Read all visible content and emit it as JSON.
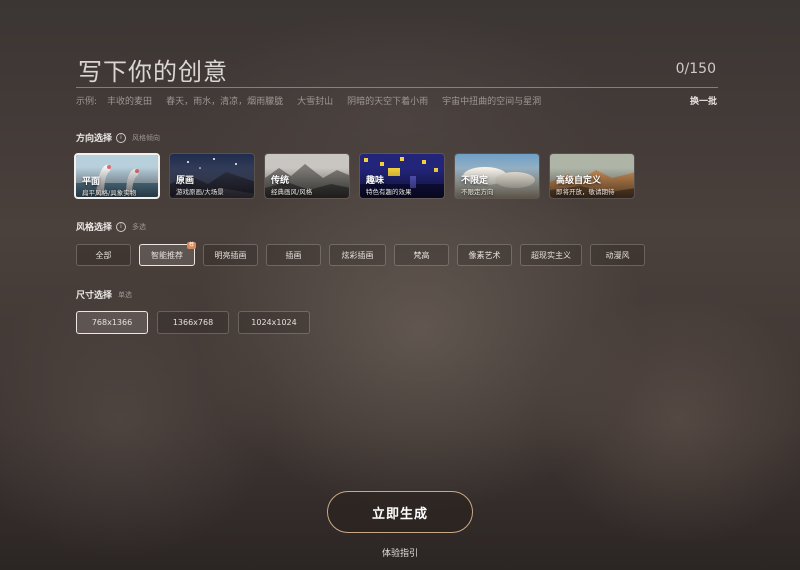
{
  "header": {
    "title": "写下你的创意",
    "counter": "0/150",
    "examples_label": "示例:",
    "examples": [
      "丰收的麦田",
      "春天，雨水，清凉，烟雨朦胧",
      "大雪封山",
      "阴暗的天空下着小雨",
      "宇宙中扭曲的空间与星洞"
    ],
    "refresh_label": "换一批"
  },
  "direction": {
    "label": "方向选择",
    "hint": "风格倾向",
    "info_icon": "info-icon",
    "cards": [
      {
        "name": "平面",
        "desc": "扁平风格/具象实物",
        "active": true,
        "colors": [
          "#cfe0ea",
          "#5d8aa3"
        ]
      },
      {
        "name": "原画",
        "desc": "游戏原画/大场景",
        "active": false,
        "colors": [
          "#2e3a5a",
          "#7f7a8a"
        ]
      },
      {
        "name": "传统",
        "desc": "经典画风/风格",
        "active": false,
        "colors": [
          "#b9b6b1",
          "#4c4a47"
        ]
      },
      {
        "name": "趣味",
        "desc": "特色有趣的效果",
        "active": false,
        "colors": [
          "#2a2a8c",
          "#d8c33a"
        ]
      },
      {
        "name": "不限定",
        "desc": "不限定方向",
        "active": false,
        "colors": [
          "#8fb8d8",
          "#e2d0b0"
        ]
      },
      {
        "name": "高级自定义",
        "desc": "即将开放，敬请期待",
        "active": false,
        "colors": [
          "#a9b1a3",
          "#c88a52"
        ]
      }
    ]
  },
  "style": {
    "label": "风格选择",
    "hint": "多选",
    "info_icon": "info-icon",
    "chips": [
      {
        "label": "全部",
        "active": false
      },
      {
        "label": "智能推荐",
        "active": true,
        "badge": "荐"
      },
      {
        "label": "明亮插画",
        "active": false
      },
      {
        "label": "插画",
        "active": false
      },
      {
        "label": "炫彩插画",
        "active": false
      },
      {
        "label": "梵高",
        "active": false
      },
      {
        "label": "像素艺术",
        "active": false
      },
      {
        "label": "超现实主义",
        "active": false
      },
      {
        "label": "动漫风",
        "active": false
      }
    ]
  },
  "size": {
    "label": "尺寸选择",
    "hint": "单选",
    "options": [
      {
        "label": "768x1366",
        "active": true
      },
      {
        "label": "1366x768",
        "active": false
      },
      {
        "label": "1024x1024",
        "active": false
      }
    ]
  },
  "actions": {
    "generate_label": "立即生成",
    "guide_label": "体验指引"
  },
  "colors": {
    "accent_border": "#c9a985",
    "badge": "#d58a5c"
  }
}
